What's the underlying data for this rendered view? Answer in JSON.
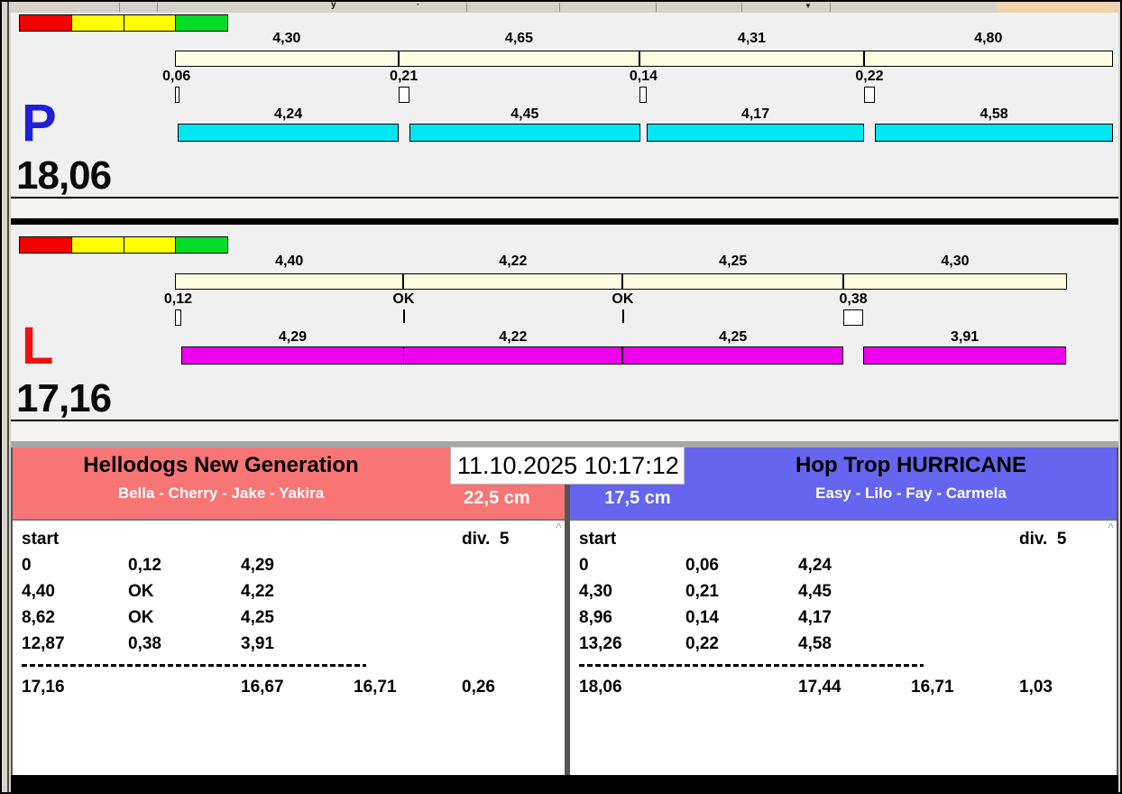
{
  "datetime": "11.10.2025 10:17:12",
  "toolbar": {
    "fragments": [
      "y",
      "·",
      "▼"
    ]
  },
  "traffic_light_colors": [
    "#f50000",
    "#ffff00",
    "#ffff00",
    "#00dc28"
  ],
  "scroll_up_glyph": "^",
  "lanes": [
    {
      "letter": "P",
      "letter_color": "#1f1fd6",
      "bar_color": "#00e6f2",
      "total_label": "18,06",
      "total_seconds": 18.06,
      "splits": [
        4.3,
        4.65,
        4.31,
        4.8
      ],
      "split_labels": [
        "4,30",
        "4,65",
        "4,31",
        "4,80"
      ],
      "gaps": [
        0.06,
        0.21,
        0.14,
        0.22
      ],
      "gap_labels": [
        "0,06",
        "0,21",
        "0,14",
        "0,22"
      ],
      "dog_times": [
        4.24,
        4.45,
        4.17,
        4.58
      ],
      "dog_time_labels": [
        "4,24",
        "4,45",
        "4,17",
        "4,58"
      ]
    },
    {
      "letter": "L",
      "letter_color": "#ee1111",
      "bar_color": "#ee00ee",
      "total_label": "17,16",
      "total_seconds": 17.16,
      "splits": [
        4.4,
        4.22,
        4.25,
        4.3
      ],
      "split_labels": [
        "4,40",
        "4,22",
        "4,25",
        "4,30"
      ],
      "gaps": [
        0.12,
        0,
        0,
        0.38
      ],
      "gap_labels": [
        "0,12",
        "OK",
        "OK",
        "0,38"
      ],
      "dog_times": [
        4.29,
        4.22,
        4.25,
        3.91
      ],
      "dog_time_labels": [
        "4,29",
        "4,22",
        "4,25",
        "3,91"
      ]
    }
  ],
  "teams": [
    {
      "name": "Hellodogs New Generation",
      "dogs": "Bella - Cherry - Jake - Yakira",
      "size": "22,5 cm",
      "header_color": "#f87575",
      "table": {
        "start_label": "start",
        "div_label": "div.  5",
        "rows": [
          [
            "0",
            "0,12",
            "4,29"
          ],
          [
            "4,40",
            "OK",
            "4,22"
          ],
          [
            "8,62",
            "OK",
            "4,25"
          ],
          [
            "12,87",
            "0,38",
            "3,91"
          ]
        ],
        "totals": [
          "17,16",
          "16,67",
          "16,71",
          "0,26"
        ]
      }
    },
    {
      "name": "Hop Trop HURRICANE",
      "dogs": "Easy - Lilo - Fay - Carmela",
      "size": "17,5 cm",
      "header_color": "#6565ef",
      "table": {
        "start_label": "start",
        "div_label": "div.  5",
        "rows": [
          [
            "0",
            "0,06",
            "4,24"
          ],
          [
            "4,30",
            "0,21",
            "4,45"
          ],
          [
            "8,96",
            "0,14",
            "4,17"
          ],
          [
            "13,26",
            "0,22",
            "4,58"
          ]
        ],
        "totals": [
          "18,06",
          "17,44",
          "16,71",
          "1,03"
        ]
      }
    }
  ]
}
